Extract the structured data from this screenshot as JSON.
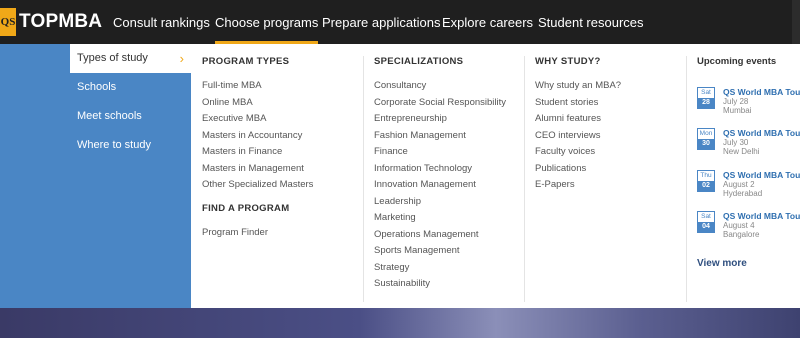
{
  "brand": {
    "badge": "QS",
    "name": "TOPMBA"
  },
  "nav": {
    "items": [
      {
        "label": "Consult rankings"
      },
      {
        "label": "Choose programs",
        "active": true
      },
      {
        "label": "Prepare applications"
      },
      {
        "label": "Explore careers"
      },
      {
        "label": "Student resources"
      }
    ]
  },
  "sidebar": {
    "items": [
      {
        "label": "Types of study",
        "active": true
      },
      {
        "label": "Schools"
      },
      {
        "label": "Meet schools"
      },
      {
        "label": "Where to study"
      }
    ]
  },
  "program_types": {
    "heading": "PROGRAM TYPES",
    "links": [
      "Full-time MBA",
      "Online MBA",
      "Executive MBA",
      "Masters in Accountancy",
      "Masters in Finance",
      "Masters in Management",
      "Other Specialized Masters"
    ],
    "sub_heading": "FIND A PROGRAM",
    "sub_links": [
      "Program Finder"
    ]
  },
  "specializations": {
    "heading": "SPECIALIZATIONS",
    "links": [
      "Consultancy",
      "Corporate Social Responsibility",
      "Entrepreneurship",
      "Fashion Management",
      "Finance",
      "Information Technology",
      "Innovation Management",
      "Leadership",
      "Marketing",
      "Operations Management",
      "Sports Management",
      "Strategy",
      "Sustainability"
    ]
  },
  "why_study": {
    "heading": "WHY STUDY?",
    "links": [
      "Why study an MBA?",
      "Student stories",
      "Alumni features",
      "CEO interviews",
      "Faculty voices",
      "Publications",
      "E-Papers"
    ]
  },
  "events": {
    "heading": "Upcoming events",
    "items": [
      {
        "day": "Sat",
        "date": "28",
        "title": "QS World MBA Tour",
        "when": "July 28",
        "city": "Mumbai"
      },
      {
        "day": "Mon",
        "date": "30",
        "title": "QS World MBA Tour",
        "when": "July 30",
        "city": "New Delhi"
      },
      {
        "day": "Thu",
        "date": "02",
        "title": "QS World MBA Tour",
        "when": "August 2",
        "city": "Hyderabad"
      },
      {
        "day": "Sat",
        "date": "04",
        "title": "QS World MBA Tour",
        "when": "August 4",
        "city": "Bangalore"
      }
    ],
    "view_more": "View more"
  },
  "colors": {
    "accent": "#f0a818",
    "nav_bg": "#1f1f1f",
    "blue": "#4a86c5"
  }
}
